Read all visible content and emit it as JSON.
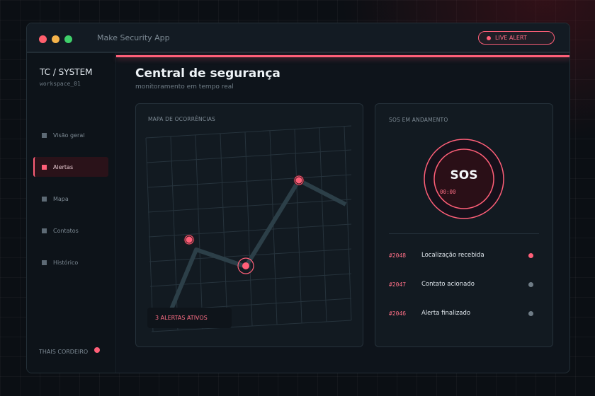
{
  "window": {
    "app_title": "Make Security App"
  },
  "header": {
    "live_alert_label": "LIVE ALERT"
  },
  "sidebar": {
    "brand": "TC / SYSTEM",
    "workspace": "workspace_01",
    "items": [
      {
        "label": "Visão geral",
        "active": false
      },
      {
        "label": "Alertas",
        "active": true
      },
      {
        "label": "Mapa",
        "active": false
      },
      {
        "label": "Contatos",
        "active": false
      },
      {
        "label": "Histórico",
        "active": false
      }
    ],
    "user_name": "THAIS CORDEIRO"
  },
  "main": {
    "title": "Central de segurança",
    "subtitle": "monitoramento em tempo real"
  },
  "map_card": {
    "title": "MAPA DE OCORRÊNCIAS",
    "alerts_badge": "3 ALERTAS ATIVOS"
  },
  "sos_card": {
    "title": "SOS EM ANDAMENTO",
    "sos_label": "SOS",
    "timer": "00:00",
    "rows": [
      {
        "id": "#2048",
        "label": "Localização recebida",
        "status": "active"
      },
      {
        "id": "#2047",
        "label": "Contato acionado",
        "status": "inactive"
      },
      {
        "id": "#2046",
        "label": "Alerta finalizado",
        "status": "inactive"
      }
    ]
  },
  "colors": {
    "accent": "#ff5f78",
    "muted_dot": "#6f7c86",
    "route": "#2c3f48",
    "background": "#0b0f14"
  },
  "icons": {
    "window_controls": [
      "close-dot-icon",
      "minimize-dot-icon",
      "maximize-dot-icon"
    ],
    "live_alert": "live-dot-icon",
    "nav": "square-icon",
    "map_pin": "alert-marker-icon"
  }
}
